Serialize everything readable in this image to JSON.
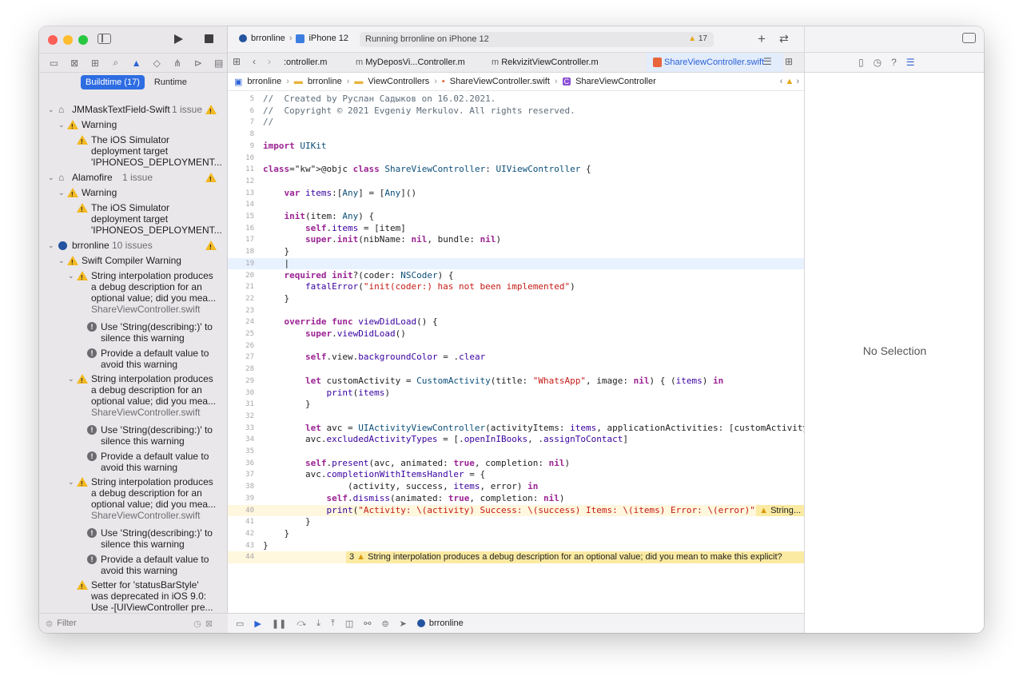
{
  "window": {
    "run_destination": {
      "scheme": "brronline",
      "device": "iPhone 12"
    },
    "activity": {
      "text": "Running brronline on iPhone 12",
      "warning_count": "17"
    }
  },
  "navigator": {
    "segments": {
      "active": "Buildtime (17)",
      "inactive": "Runtime"
    },
    "filter_placeholder": "Filter",
    "issues": [
      {
        "kind": "group",
        "title": "JMMaskTextField-Swift",
        "count": "1 issue"
      },
      {
        "kind": "category",
        "title": "Warning"
      },
      {
        "kind": "warning",
        "lines": [
          "The iOS Simulator",
          "deployment target",
          "'IPHONEOS_DEPLOYMENT..."
        ]
      },
      {
        "kind": "group",
        "title": "Alamofire",
        "count": "1 issue"
      },
      {
        "kind": "category",
        "title": "Warning"
      },
      {
        "kind": "warning",
        "lines": [
          "The iOS Simulator",
          "deployment target",
          "'IPHONEOS_DEPLOYMENT..."
        ]
      },
      {
        "kind": "group",
        "title": "brronline",
        "count": "10 issues"
      },
      {
        "kind": "category",
        "title": "Swift Compiler Warning"
      },
      {
        "kind": "warning",
        "lines": [
          "String interpolation produces",
          "a debug description for an",
          "optional value; did you mea..."
        ],
        "file": "ShareViewController.swift"
      },
      {
        "kind": "fix",
        "lines": [
          "Use 'String(describing:)' to",
          "silence this warning"
        ]
      },
      {
        "kind": "fix",
        "lines": [
          "Provide a default value to",
          "avoid this warning"
        ]
      },
      {
        "kind": "warning",
        "lines": [
          "String interpolation produces",
          "a debug description for an",
          "optional value; did you mea..."
        ],
        "file": "ShareViewController.swift"
      },
      {
        "kind": "fix",
        "lines": [
          "Use 'String(describing:)' to",
          "silence this warning"
        ]
      },
      {
        "kind": "fix",
        "lines": [
          "Provide a default value to",
          "avoid this warning"
        ]
      },
      {
        "kind": "warning",
        "lines": [
          "String interpolation produces",
          "a debug description for an",
          "optional value; did you mea..."
        ],
        "file": "ShareViewController.swift"
      },
      {
        "kind": "fix",
        "lines": [
          "Use 'String(describing:)' to",
          "silence this warning"
        ]
      },
      {
        "kind": "fix",
        "lines": [
          "Provide a default value to",
          "avoid this warning"
        ]
      },
      {
        "kind": "warning",
        "lines": [
          "Setter for 'statusBarStyle'",
          "was deprecated in iOS 9.0:",
          "Use -[UIViewController pre..."
        ]
      }
    ]
  },
  "editor": {
    "tabs": [
      {
        "label": ":ontroller.m",
        "icon": "m"
      },
      {
        "label": "MyDeposVi...Controller.m",
        "icon": "m"
      },
      {
        "label": "RekvizitViewController.m",
        "icon": "m"
      },
      {
        "label": "ShareViewController.swift",
        "icon": "swift",
        "active": true
      }
    ],
    "breadcrumbs": [
      "brronline",
      "brronline",
      "ViewControllers",
      "ShareViewController.swift",
      "ShareViewController"
    ],
    "lines": [
      {
        "n": "5",
        "t": "//  Created by Руслан Садыков on 16.02.2021."
      },
      {
        "n": "6",
        "t": "//  Copyright © 2021 Evgeniy Merkulov. All rights reserved."
      },
      {
        "n": "7",
        "t": "//"
      },
      {
        "n": "8",
        "t": ""
      },
      {
        "n": "9",
        "t": "import UIKit"
      },
      {
        "n": "10",
        "t": ""
      },
      {
        "n": "11",
        "t": "@objc class ShareViewController: UIViewController {"
      },
      {
        "n": "12",
        "t": ""
      },
      {
        "n": "13",
        "t": "    var items:[Any] = [Any]()"
      },
      {
        "n": "14",
        "t": ""
      },
      {
        "n": "15",
        "t": "    init(item: Any) {"
      },
      {
        "n": "16",
        "t": "        self.items = [item]"
      },
      {
        "n": "17",
        "t": "        super.init(nibName: nil, bundle: nil)"
      },
      {
        "n": "18",
        "t": "    }"
      },
      {
        "n": "19",
        "t": "    |"
      },
      {
        "n": "20",
        "t": "    required init?(coder: NSCoder) {"
      },
      {
        "n": "21",
        "t": "        fatalError(\"init(coder:) has not been implemented\")"
      },
      {
        "n": "22",
        "t": "    }"
      },
      {
        "n": "23",
        "t": ""
      },
      {
        "n": "24",
        "t": "    override func viewDidLoad() {"
      },
      {
        "n": "25",
        "t": "        super.viewDidLoad()"
      },
      {
        "n": "26",
        "t": ""
      },
      {
        "n": "27",
        "t": "        self.view.backgroundColor = .clear"
      },
      {
        "n": "28",
        "t": ""
      },
      {
        "n": "29",
        "t": "        let customActivity = CustomActivity(title: \"WhatsApp\", image: nil) { (items) in"
      },
      {
        "n": "30",
        "t": "            print(items)"
      },
      {
        "n": "31",
        "t": "        }"
      },
      {
        "n": "32",
        "t": ""
      },
      {
        "n": "33",
        "t": "        let avc = UIActivityViewController(activityItems: items, applicationActivities: [customActivity])"
      },
      {
        "n": "34",
        "t": "        avc.excludedActivityTypes = [.openInIBooks, .assignToContact]"
      },
      {
        "n": "35",
        "t": ""
      },
      {
        "n": "36",
        "t": "        self.present(avc, animated: true, completion: nil)"
      },
      {
        "n": "37",
        "t": "        avc.completionWithItemsHandler = {"
      },
      {
        "n": "38",
        "t": "                (activity, success, items, error) in"
      },
      {
        "n": "39",
        "t": "            self.dismiss(animated: true, completion: nil)"
      },
      {
        "n": "40",
        "t": "            print(\"Activity: \\(activity) Success: \\(success) Items: \\(items) Error: \\(error)\")"
      },
      {
        "n": "41",
        "t": "        }"
      },
      {
        "n": "42",
        "t": "    }"
      },
      {
        "n": "43",
        "t": "}"
      },
      {
        "n": "44",
        "t": ""
      }
    ],
    "inline_warning_short": "String...",
    "inline_warning_count": "3",
    "inline_warning_full": "String interpolation produces a debug description for an optional value; did you mean to make this explicit?",
    "debug_target": "brronline"
  },
  "inspector": {
    "empty_text": "No Selection"
  }
}
